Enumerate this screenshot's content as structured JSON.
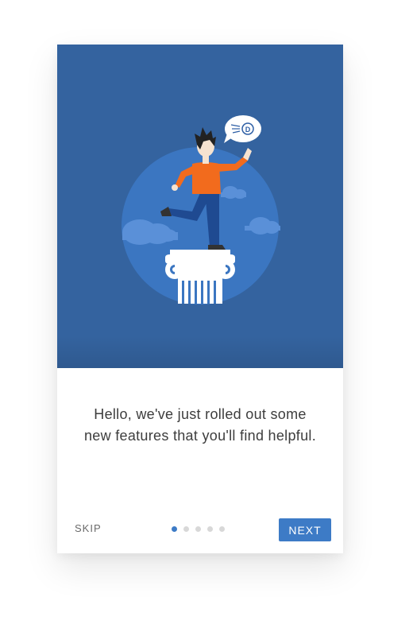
{
  "onboarding": {
    "message": "Hello, we've just rolled out some new features that you'll find helpful.",
    "skip_label": "SKIP",
    "next_label": "NEXT",
    "current_page": 1,
    "total_pages": 5,
    "speech_bubble_letter": "D"
  },
  "colors": {
    "hero_background": "#34639f",
    "circle": "#3b76c1",
    "accent": "#3d7bc6",
    "shirt": "#f26b1d",
    "pants": "#1f4a91"
  }
}
